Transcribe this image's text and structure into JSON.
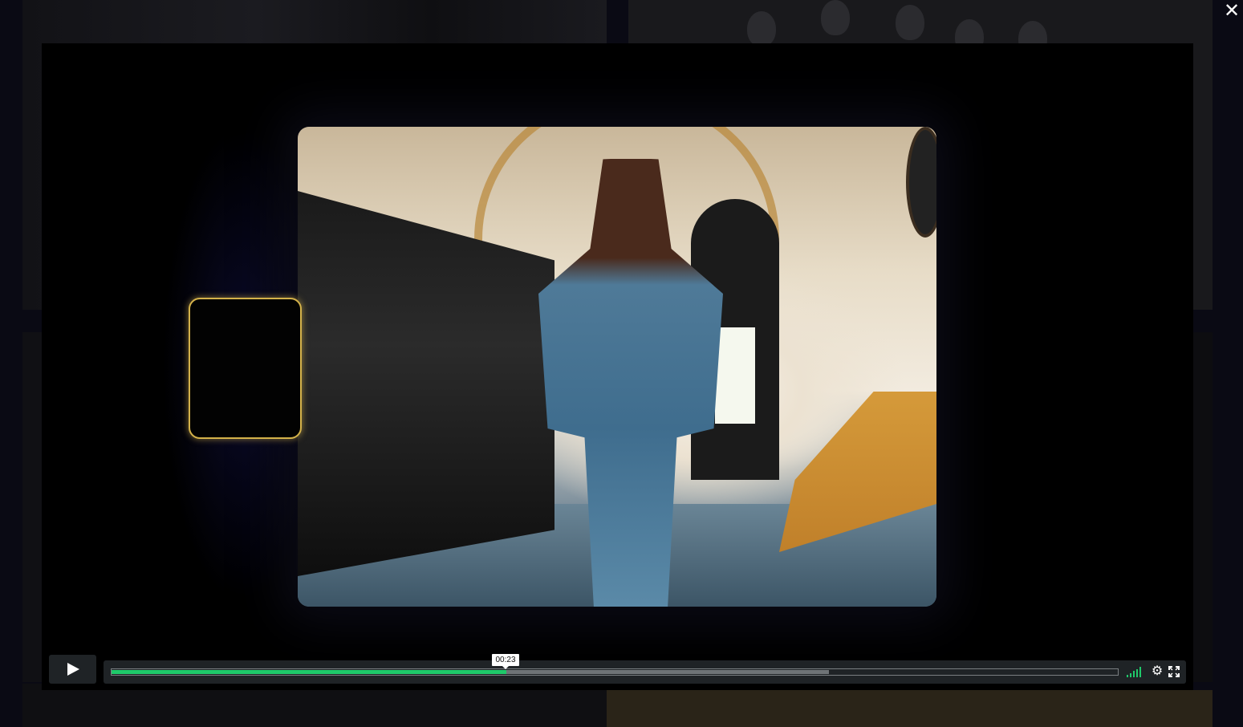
{
  "page": {
    "close_glyph": "✕"
  },
  "player": {
    "current_time": "00:23",
    "progress": {
      "played_fraction": 0.392,
      "buffered_fraction": 0.713
    },
    "volume_level_fraction": 1.0,
    "accent_color": "#1fc96a",
    "settings_glyph": "⚙"
  },
  "icons": {
    "close": "close-icon",
    "play": "play-icon",
    "volume": "volume-icon",
    "settings": "gear-icon",
    "fullscreen": "fullscreen-icon"
  }
}
